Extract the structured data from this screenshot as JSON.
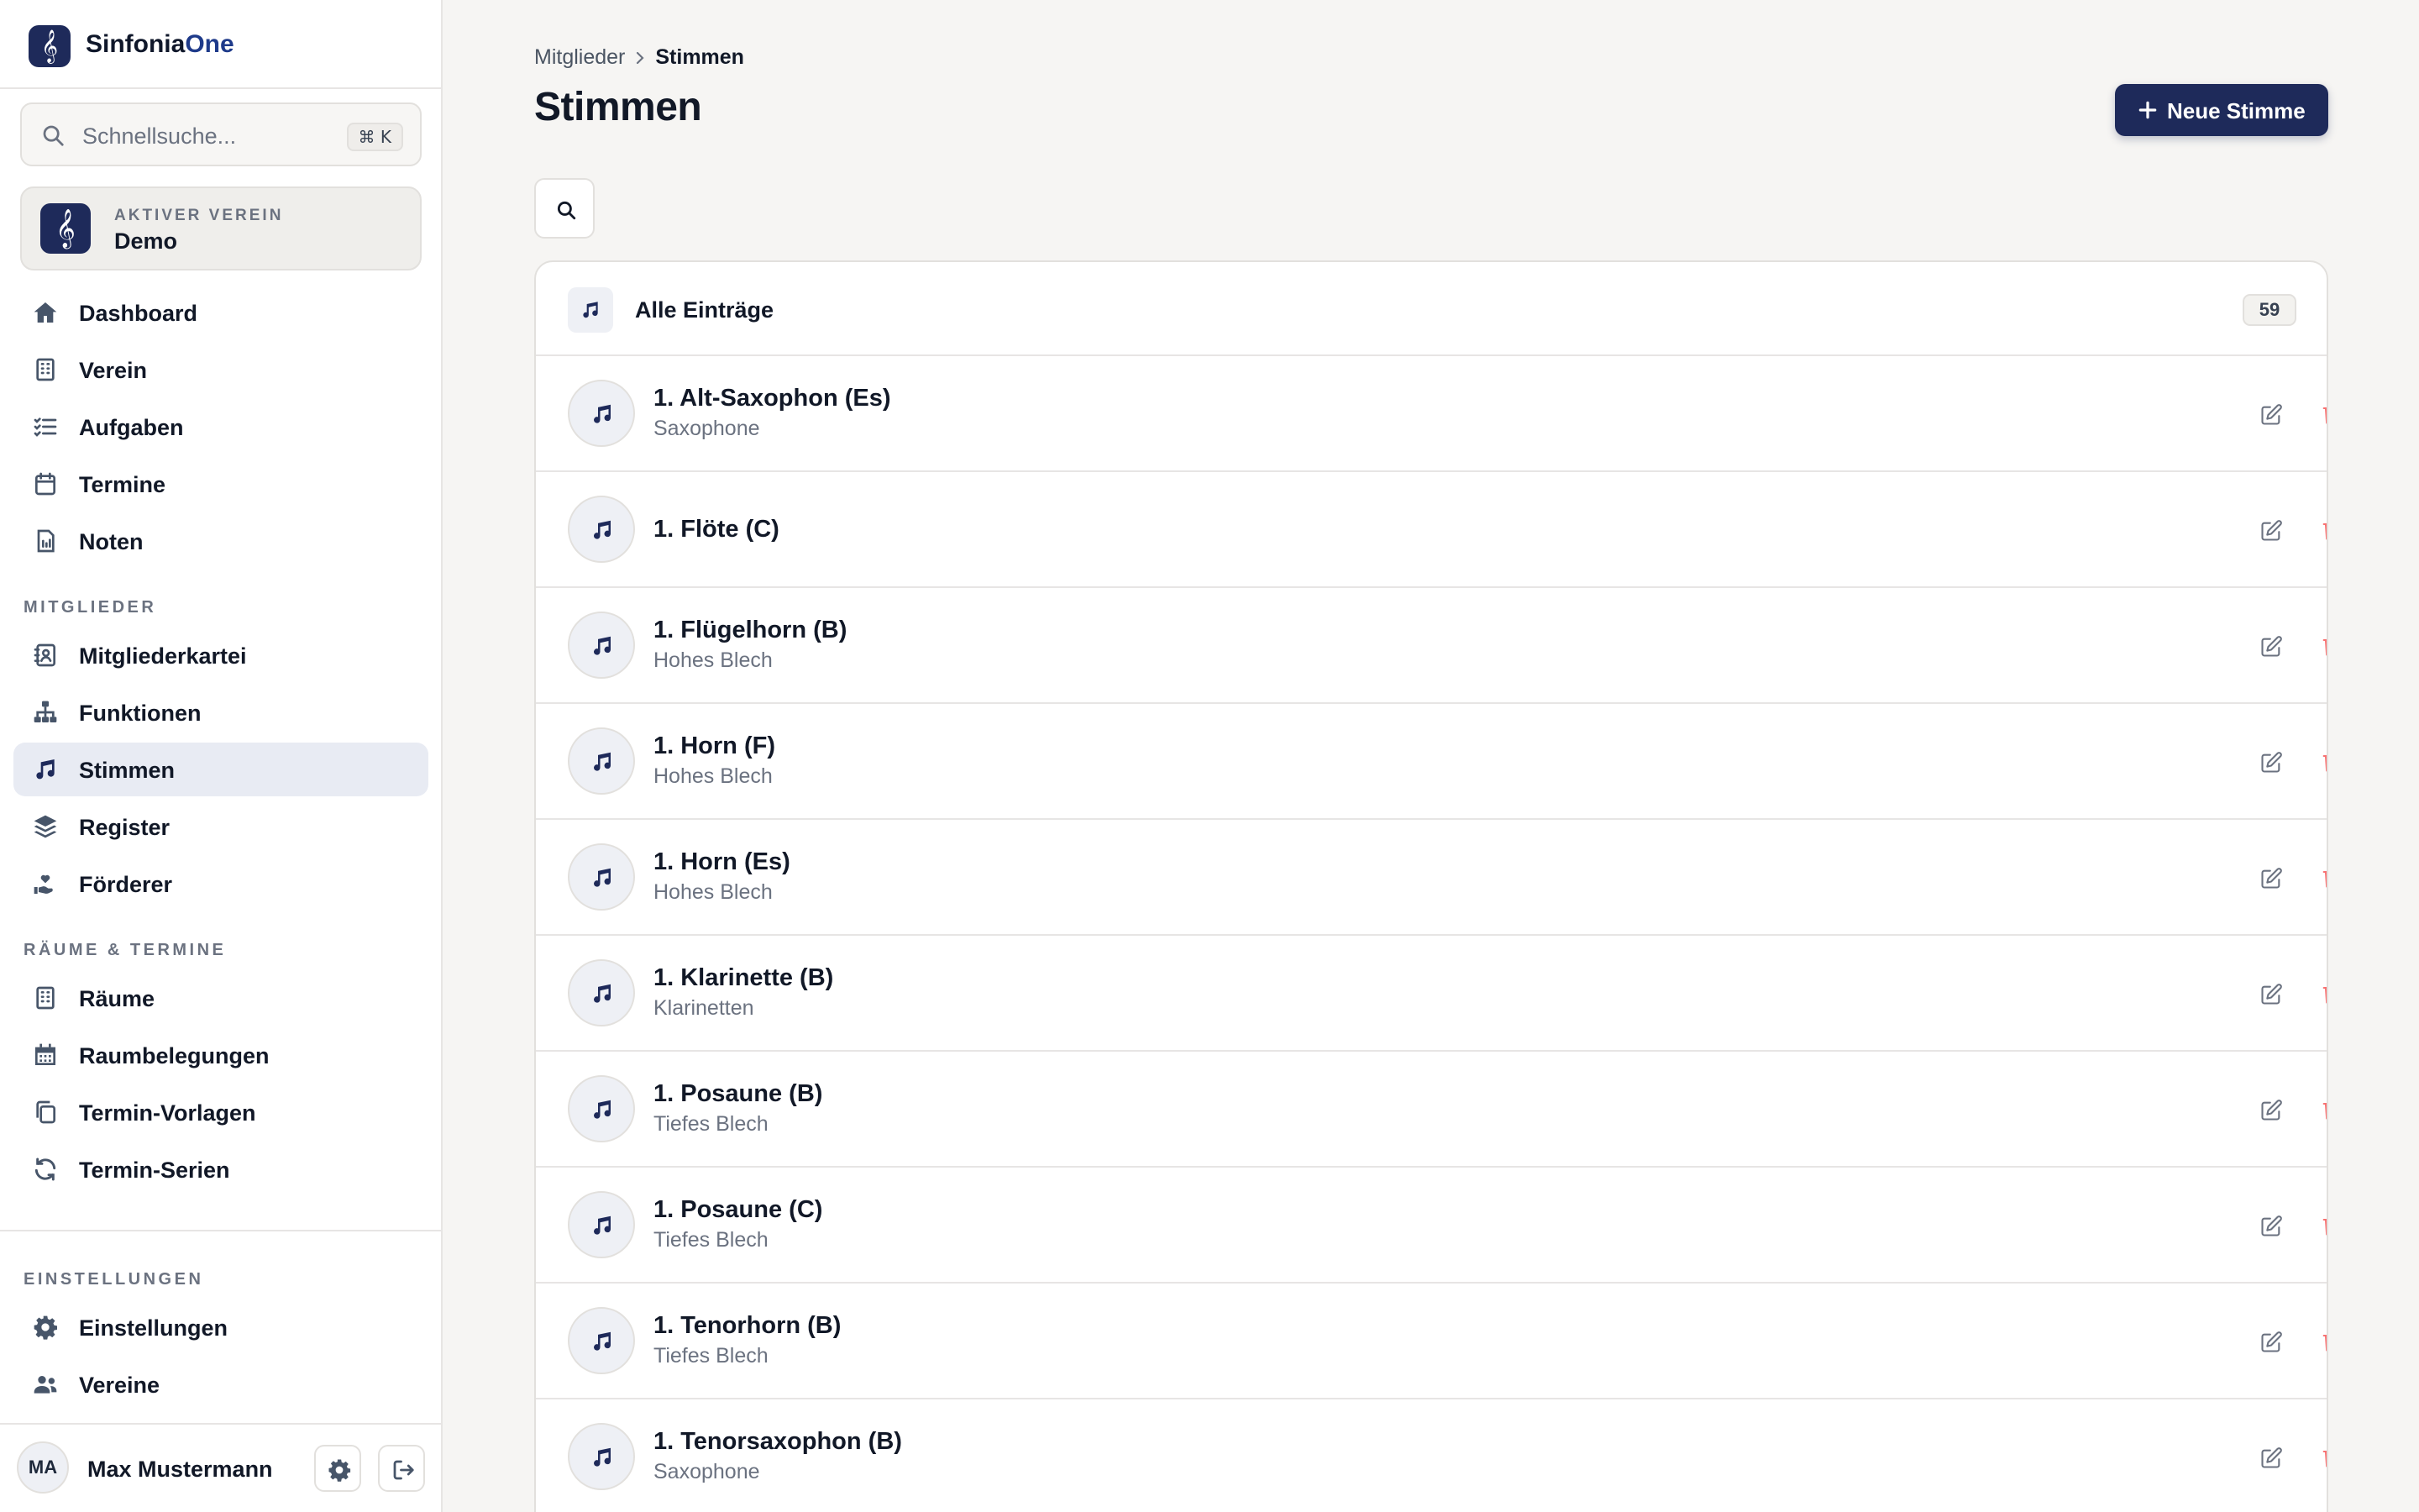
{
  "brand": {
    "name_part1": "Sinfonia",
    "name_part2": "One",
    "logo_glyph": "𝄞"
  },
  "search": {
    "placeholder": "Schnellsuche...",
    "shortcut": "⌘ K"
  },
  "active_club": {
    "label": "AKTIVER VEREIN",
    "name": "Demo"
  },
  "nav_main": [
    {
      "label": "Dashboard",
      "icon": "home-icon"
    },
    {
      "label": "Verein",
      "icon": "building-icon"
    },
    {
      "label": "Aufgaben",
      "icon": "checklist-icon"
    },
    {
      "label": "Termine",
      "icon": "calendar-icon"
    },
    {
      "label": "Noten",
      "icon": "sheet-music-icon"
    }
  ],
  "section_members": "MITGLIEDER",
  "nav_members": [
    {
      "label": "Mitgliederkartei",
      "icon": "address-book-icon"
    },
    {
      "label": "Funktionen",
      "icon": "org-chart-icon"
    },
    {
      "label": "Stimmen",
      "icon": "music-note-icon",
      "active": true
    },
    {
      "label": "Register",
      "icon": "layers-icon"
    },
    {
      "label": "Förderer",
      "icon": "hand-heart-icon"
    }
  ],
  "section_rooms": "RÄUME & TERMINE",
  "nav_rooms": [
    {
      "label": "Räume",
      "icon": "building-icon"
    },
    {
      "label": "Raumbelegungen",
      "icon": "calendar-grid-icon"
    },
    {
      "label": "Termin-Vorlagen",
      "icon": "copy-icon"
    },
    {
      "label": "Termin-Serien",
      "icon": "refresh-icon"
    }
  ],
  "section_settings": "EINSTELLUNGEN",
  "nav_settings": [
    {
      "label": "Einstellungen",
      "icon": "gear-icon"
    },
    {
      "label": "Vereine",
      "icon": "users-icon"
    }
  ],
  "user": {
    "initials": "MA",
    "name": "Max Mustermann"
  },
  "breadcrumb": {
    "parent": "Mitglieder",
    "current": "Stimmen"
  },
  "page_title": "Stimmen",
  "new_button": "Neue Stimme",
  "list_header": {
    "title": "Alle Einträge",
    "count": "59"
  },
  "entries": [
    {
      "name": "1. Alt-Saxophon (Es)",
      "group": "Saxophone"
    },
    {
      "name": "1. Flöte (C)",
      "group": ""
    },
    {
      "name": "1. Flügelhorn (B)",
      "group": "Hohes Blech"
    },
    {
      "name": "1. Horn (F)",
      "group": "Hohes Blech"
    },
    {
      "name": "1. Horn (Es)",
      "group": "Hohes Blech"
    },
    {
      "name": "1. Klarinette (B)",
      "group": "Klarinetten"
    },
    {
      "name": "1. Posaune (B)",
      "group": "Tiefes Blech"
    },
    {
      "name": "1. Posaune (C)",
      "group": "Tiefes Blech"
    },
    {
      "name": "1. Tenorhorn (B)",
      "group": "Tiefes Blech"
    },
    {
      "name": "1. Tenorsaxophon (B)",
      "group": "Saxophone"
    }
  ],
  "colors": {
    "primary": "#1e2a5a",
    "delete": "#f87171",
    "active_nav_bg": "#e8ebf3",
    "page_bg": "#f6f5f3"
  }
}
